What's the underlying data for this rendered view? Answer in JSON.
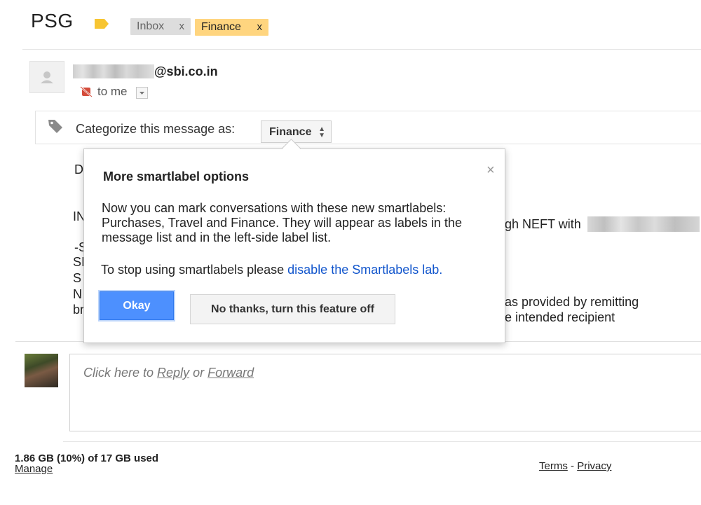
{
  "header": {
    "subject": "PSG",
    "labels": [
      {
        "name": "Inbox",
        "remove": "x"
      },
      {
        "name": "Finance",
        "remove": "x"
      }
    ]
  },
  "sender": {
    "email_suffix": "@sbi.co.in",
    "to_text": "to me"
  },
  "categorize": {
    "prompt": "Categorize this message as:",
    "selected": "Finance",
    "arrows": "▲▼"
  },
  "body_fragments": {
    "line1": "D",
    "line2": "IN",
    "line2_end": "gh NEFT with",
    "line3": "-S",
    "line4": "SI",
    "line5": "S",
    "line6": "N",
    "line6_end": "as provided by remitting",
    "line7": "br",
    "line7_end": "e intended recipient"
  },
  "popup": {
    "title": "More smartlabel options",
    "close": "×",
    "paragraph": "Now you can mark conversations with these new smartlabels: Purchases, Travel and Finance. They will appear as labels in the message list and in the left-side label list.",
    "stop_text": "To stop using smartlabels please ",
    "stop_link": "disable the Smartlabels lab.",
    "okay_button": "Okay",
    "no_thanks_button": "No thanks, turn this feature off"
  },
  "reply": {
    "prefix": "Click here to ",
    "reply_link": "Reply",
    "middle": " or ",
    "forward_link": "Forward"
  },
  "footer": {
    "storage": "1.86 GB (10%) of 17 GB used",
    "manage": "Manage",
    "terms": "Terms",
    "separator": " - ",
    "privacy": "Privacy"
  },
  "colors": {
    "finance_label": "#ffd57f",
    "inbox_label": "#dddddd",
    "primary_button": "#4d90fe",
    "link": "#1155cc"
  }
}
